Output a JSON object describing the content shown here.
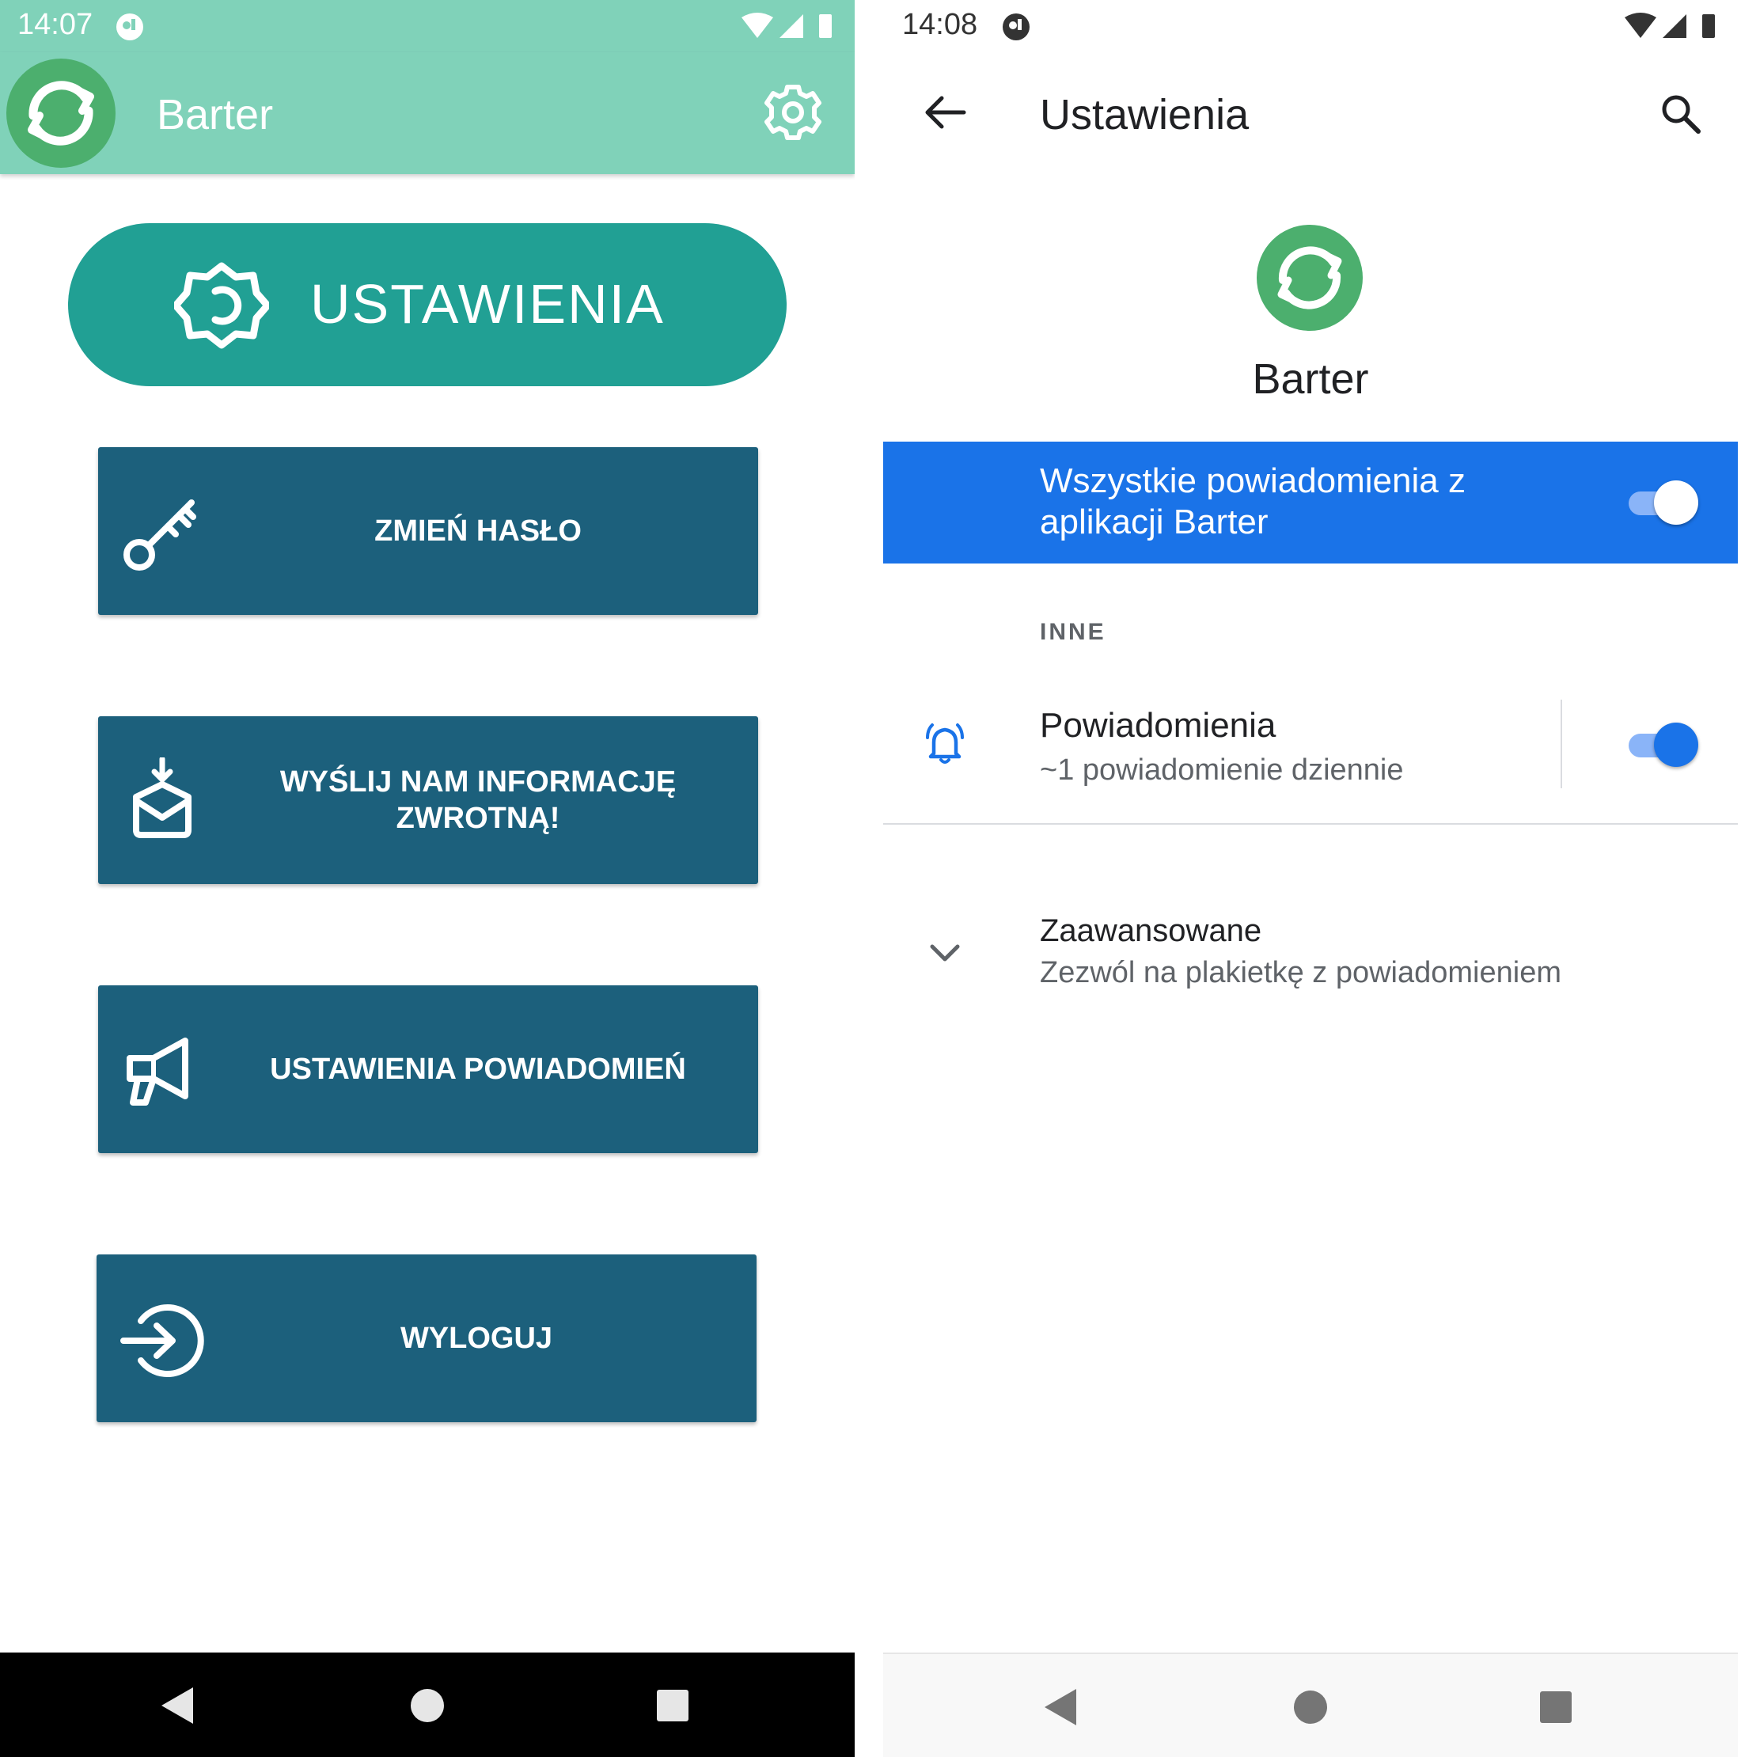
{
  "left": {
    "status": {
      "time": "14:07"
    },
    "appbar": {
      "title": "Barter"
    },
    "header_button": {
      "label": "USTAWIENIA"
    },
    "menu": [
      {
        "label": "ZMIEŃ HASŁO",
        "icon": "key-icon"
      },
      {
        "label": "WYŚLIJ NAM INFORMACJĘ ZWROTNĄ!",
        "icon": "mail-download-icon"
      },
      {
        "label": "USTAWIENIA POWIADOMIEŃ",
        "icon": "megaphone-icon"
      },
      {
        "label": "WYLOGUJ",
        "icon": "logout-icon"
      }
    ]
  },
  "right": {
    "status": {
      "time": "14:08"
    },
    "toolbar": {
      "title": "Ustawienia"
    },
    "app": {
      "name": "Barter"
    },
    "master_toggle": {
      "label": "Wszystkie powiadomienia z aplikacji Barter",
      "on": true
    },
    "section": {
      "title": "INNE"
    },
    "notification_row": {
      "title": "Powiadomienia",
      "subtitle": "~1 powiadomienie dziennie",
      "on": true
    },
    "advanced_row": {
      "title": "Zaawansowane",
      "subtitle": "Zezwól na plakietkę z powiadomieniem"
    }
  },
  "colors": {
    "left_appbar": "#80d2b9",
    "pill": "#21a094",
    "menu_button": "#1c607c",
    "app_logo": "#4caf6e",
    "accent_blue": "#1a73e8"
  }
}
